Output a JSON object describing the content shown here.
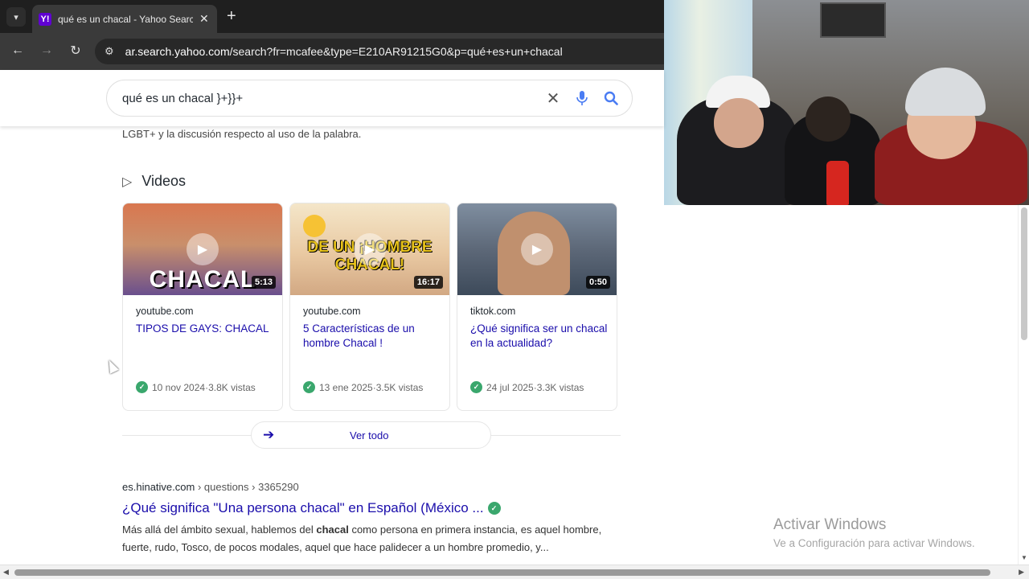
{
  "browser": {
    "tab_title": "qué es un chacal - Yahoo Search",
    "favicon_letter": "Y!",
    "close_glyph": "✕",
    "new_tab_glyph": "+",
    "url_domain": "ar.search.yahoo.com",
    "url_path": "/search?fr=mcafee&type=E210AR91215G0&p=qué+es+un+chacal"
  },
  "search": {
    "query": "qué es un chacal }+}}+"
  },
  "results": {
    "top_snippet": "LGBT+ y la discusión respecto al uso de la palabra.",
    "videos_label": "Videos",
    "videos": [
      {
        "thumb_text": "CHACAL",
        "duration": "5:13",
        "source": "youtube.com",
        "title": "TIPOS DE GAYS: CHACAL",
        "date": "10 nov 2024",
        "views": "3.8K vistas"
      },
      {
        "thumb_text": "DE UN ¡HOMBRE CHACAL!",
        "duration": "16:17",
        "source": "youtube.com",
        "title": "5 Características de un hombre Chacal !",
        "date": "13 ene 2025",
        "views": "3.5K vistas"
      },
      {
        "thumb_text": "",
        "duration": "0:50",
        "source": "tiktok.com",
        "title": "¿Qué significa ser un chacal en la actualidad?",
        "date": "24 jul 2025",
        "views": "3.3K vistas"
      }
    ],
    "see_all": "Ver todo",
    "meta_sep": " · ",
    "result2": {
      "domain": "es.hinative.com",
      "crumbs": " › questions › 3365290",
      "title": "¿Qué significa \"Una persona chacal\" en Español (México ...",
      "desc_1": "Más allá del ámbito sexual, hablemos del ",
      "desc_bold": "chacal",
      "desc_2": " como persona en primera instancia, es aquel hombre, fuerte, rudo, Tosco, de pocos modales, aquel que hace palidecer a un hombre promedio, y..."
    }
  },
  "watermark": {
    "line1": "Activar Windows",
    "line2": "Ve a Configuración para activar Windows."
  },
  "colors": {
    "link": "#1a0dab",
    "verified": "#3aa76d",
    "yahoo_purple": "#6001d2",
    "accent_blue": "#4a7cf3"
  }
}
